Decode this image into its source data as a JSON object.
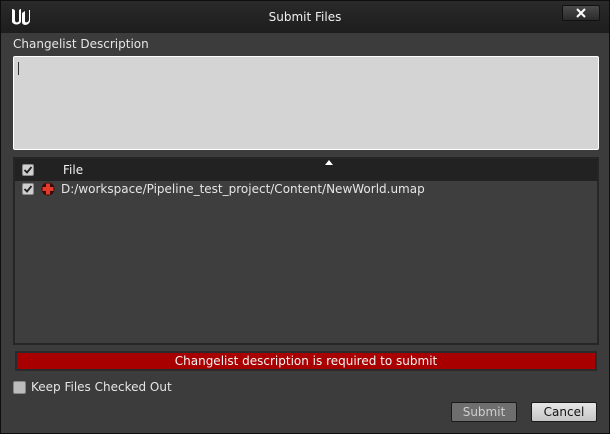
{
  "window": {
    "title": "Submit Files",
    "close_icon": "close-icon"
  },
  "description": {
    "label": "Changelist Description",
    "value": ""
  },
  "file_list": {
    "header": {
      "file_label": "File",
      "sort": "ascending"
    },
    "rows": [
      {
        "checked": true,
        "status_icon": "add-icon",
        "path": "D:/workspace/Pipeline_test_project/Content/NewWorld.umap"
      }
    ]
  },
  "error": {
    "message": "Changelist description is required to submit",
    "color": "#a80000"
  },
  "options": {
    "keep_checked_out_label": "Keep Files Checked Out",
    "keep_checked_out": false
  },
  "buttons": {
    "submit_label": "Submit",
    "submit_enabled": false,
    "cancel_label": "Cancel"
  }
}
